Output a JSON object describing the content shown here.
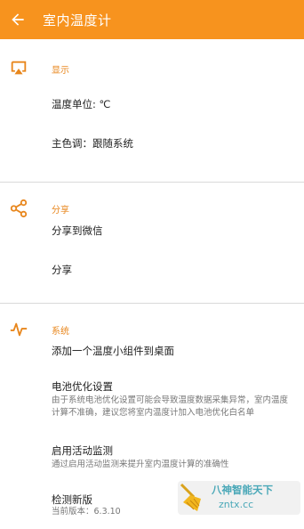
{
  "appbar": {
    "title": "室内温度计",
    "back_icon": "arrow-left-icon"
  },
  "colors": {
    "appbar": "#f7931e",
    "accent": "#e8861c"
  },
  "sections": {
    "display": {
      "label": "显示",
      "icon": "airplay-icon",
      "items": {
        "unit": "温度单位: ℃",
        "theme": "主色调：跟随系统"
      }
    },
    "share": {
      "label": "分享",
      "icon": "share-icon",
      "items": {
        "wechat": "分享到微信",
        "share": "分享"
      }
    },
    "system": {
      "label": "系统",
      "icon": "pulse-icon",
      "items": {
        "widget": "添加一个温度小组件到桌面",
        "battery_title": "电池优化设置",
        "battery_desc": "由于系统电池优化设置可能会导致温度数据采集异常，室内温度计算不准确，建议您将室内温度计加入电池优化白名单",
        "activity_title": "启用活动监测",
        "activity_desc": "通过启用活动监测来提升室内温度计算的准确性",
        "update_title": "检测新版",
        "update_desc": "当前版本：6.3.10"
      }
    }
  },
  "watermark": {
    "title": "八神智能天下",
    "url": "zntx.cc"
  }
}
